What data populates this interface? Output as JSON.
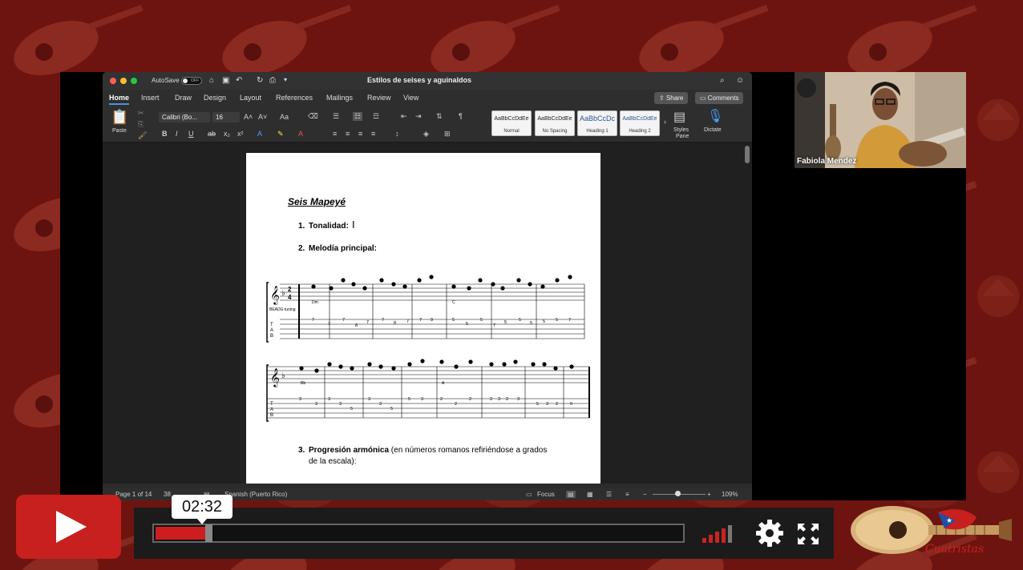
{
  "word": {
    "autosave_label": "AutoSave",
    "autosave_state": "OFF",
    "doc_title": "Estilos de seises y aguinaldos",
    "tabs": [
      "Home",
      "Insert",
      "Draw",
      "Design",
      "Layout",
      "References",
      "Mailings",
      "Review",
      "View"
    ],
    "share_label": "Share",
    "comments_label": "Comments",
    "paste_label": "Paste",
    "font_name": "Calibri (Bo...",
    "font_size": "16",
    "styles": [
      {
        "preview": "AaBbCcDdEe",
        "label": "Normal"
      },
      {
        "preview": "AaBbCcDdEe",
        "label": "No Spacing"
      },
      {
        "preview": "AaBbCcDc",
        "label": "Heading 1"
      },
      {
        "preview": "AaBbCcDdEe",
        "label": "Heading 2"
      }
    ],
    "styles_pane_label_1": "Styles",
    "styles_pane_label_2": "Pane",
    "dictate_label": "Dictate",
    "status": {
      "page": "Page 1 of 14",
      "words": "38",
      "language": "Spanish (Puerto Rico)",
      "focus": "Focus",
      "zoom": "109%"
    }
  },
  "document": {
    "heading": "Seis Mapeyé",
    "item1_num": "1.",
    "item1_label": "Tonalidad:",
    "item2_num": "2.",
    "item2_label": "Melodía principal:",
    "staff1_tuning": "BEADG tuning",
    "staff1_chords": [
      "Dm",
      "C"
    ],
    "staff2_chords": [
      "Bb",
      "A"
    ],
    "item3_num": "3.",
    "item3_bold": "Progresión armónica",
    "item3_rest": " (en números romanos refiriéndose a grados",
    "item3_line2": "de la escala):"
  },
  "camera": {
    "participant_name": "Fabiola Mendez"
  },
  "player": {
    "time": "02:32",
    "progress_fraction": 0.1,
    "accent_color": "#cc1e1e",
    "icons": [
      "play-icon",
      "volume-icon",
      "gear-icon",
      "fullscreen-icon"
    ]
  }
}
